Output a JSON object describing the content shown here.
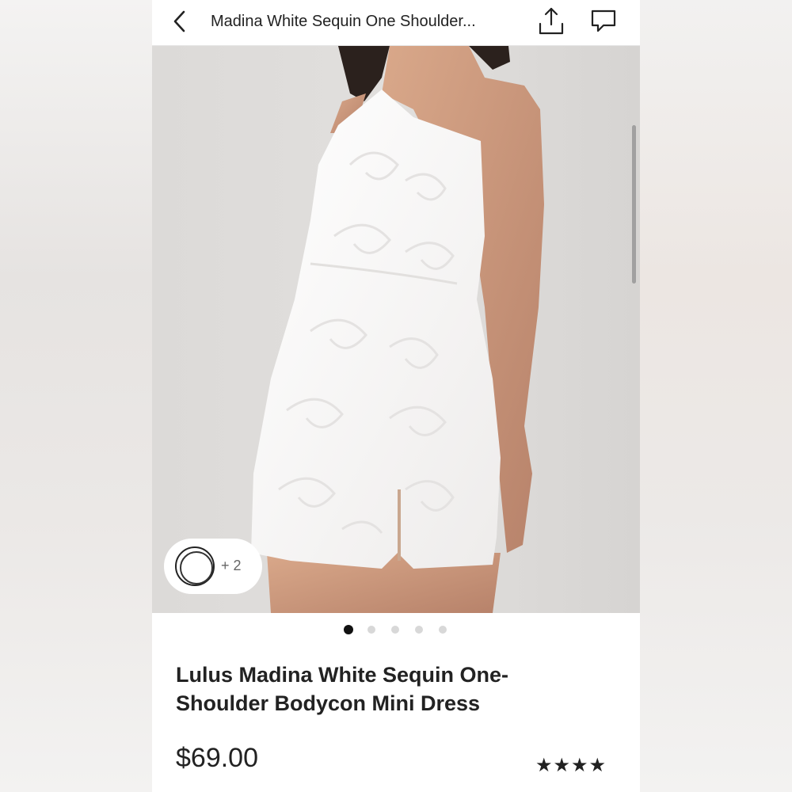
{
  "header": {
    "title": "Madina White Sequin One Shoulder...",
    "back_icon": "chevron-left-icon",
    "share_icon": "share-icon",
    "comment_icon": "comment-icon"
  },
  "gallery": {
    "image_description": "",
    "swatch_more": "+ 2",
    "dot_count": 5,
    "active_dot": 1
  },
  "product": {
    "title": "Lulus Madina White Sequin One-Shoulder Bodycon Mini Dress",
    "price": "$69.00",
    "rating_stars": "★★★★",
    "rating": 4
  },
  "colors": {
    "background": "#ffffff",
    "text": "#222222",
    "dot_active": "#111111",
    "dot_inactive": "#d8d8d8"
  }
}
